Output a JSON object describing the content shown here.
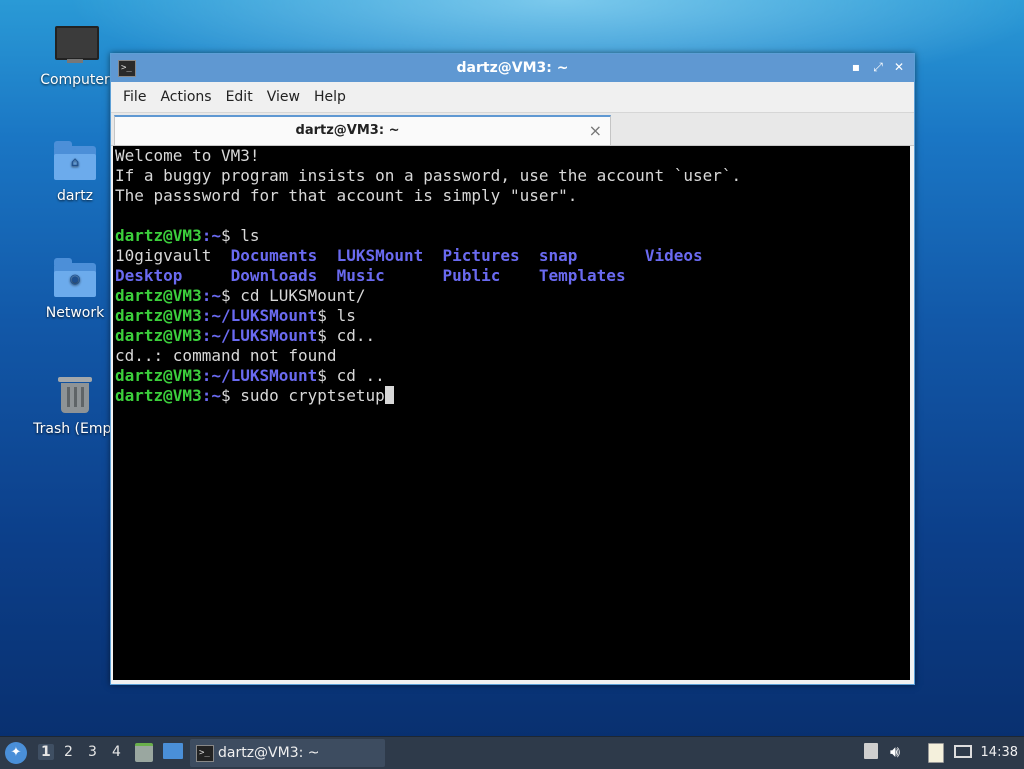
{
  "desktop": {
    "icons": [
      {
        "label": "Computer"
      },
      {
        "label": "dartz"
      },
      {
        "label": "Network"
      },
      {
        "label": "Trash (Empt"
      }
    ]
  },
  "window": {
    "title": "dartz@VM3: ~",
    "controls": {
      "minimize": "▪",
      "maximize": "⤢",
      "close": "✕"
    },
    "menu": [
      "File",
      "Actions",
      "Edit",
      "View",
      "Help"
    ],
    "tab": {
      "label": "dartz@VM3: ~",
      "close": "×"
    }
  },
  "terminal": {
    "user_host": "dartz@VM3",
    "lines": {
      "welcome1": "Welcome to VM3!",
      "welcome2": "If a buggy program insists on a password, use the account `user`.",
      "welcome3": "The passsword for that account is simply \"user\".",
      "p1_path": ":~",
      "p1_cmd": "$ ls",
      "ls_row1": {
        "plain": "10gigvault",
        "d1": "Documents",
        "d2": "LUKSMount",
        "d3": "Pictures",
        "d4": "snap",
        "d5": "Videos"
      },
      "ls_row2": {
        "d1": "Desktop",
        "d2": "Downloads",
        "d3": "Music",
        "d4": "Public",
        "d5": "Templates"
      },
      "p2_path": ":~",
      "p2_cmd": "$ cd LUKSMount/",
      "p3_path": ":~/LUKSMount",
      "p3_cmd": "$ ls",
      "p4_path": ":~/LUKSMount",
      "p4_cmd": "$ cd..",
      "error": "cd..: command not found",
      "p5_path": ":~/LUKSMount",
      "p5_cmd": "$ cd ..",
      "p6_path": ":~",
      "p6_cmd": "$ sudo cryptsetup"
    }
  },
  "taskbar": {
    "workspaces": [
      "1",
      "2",
      "3",
      "4"
    ],
    "active_workspace": "1",
    "task_label": "dartz@VM3: ~",
    "clock": "14:38"
  }
}
